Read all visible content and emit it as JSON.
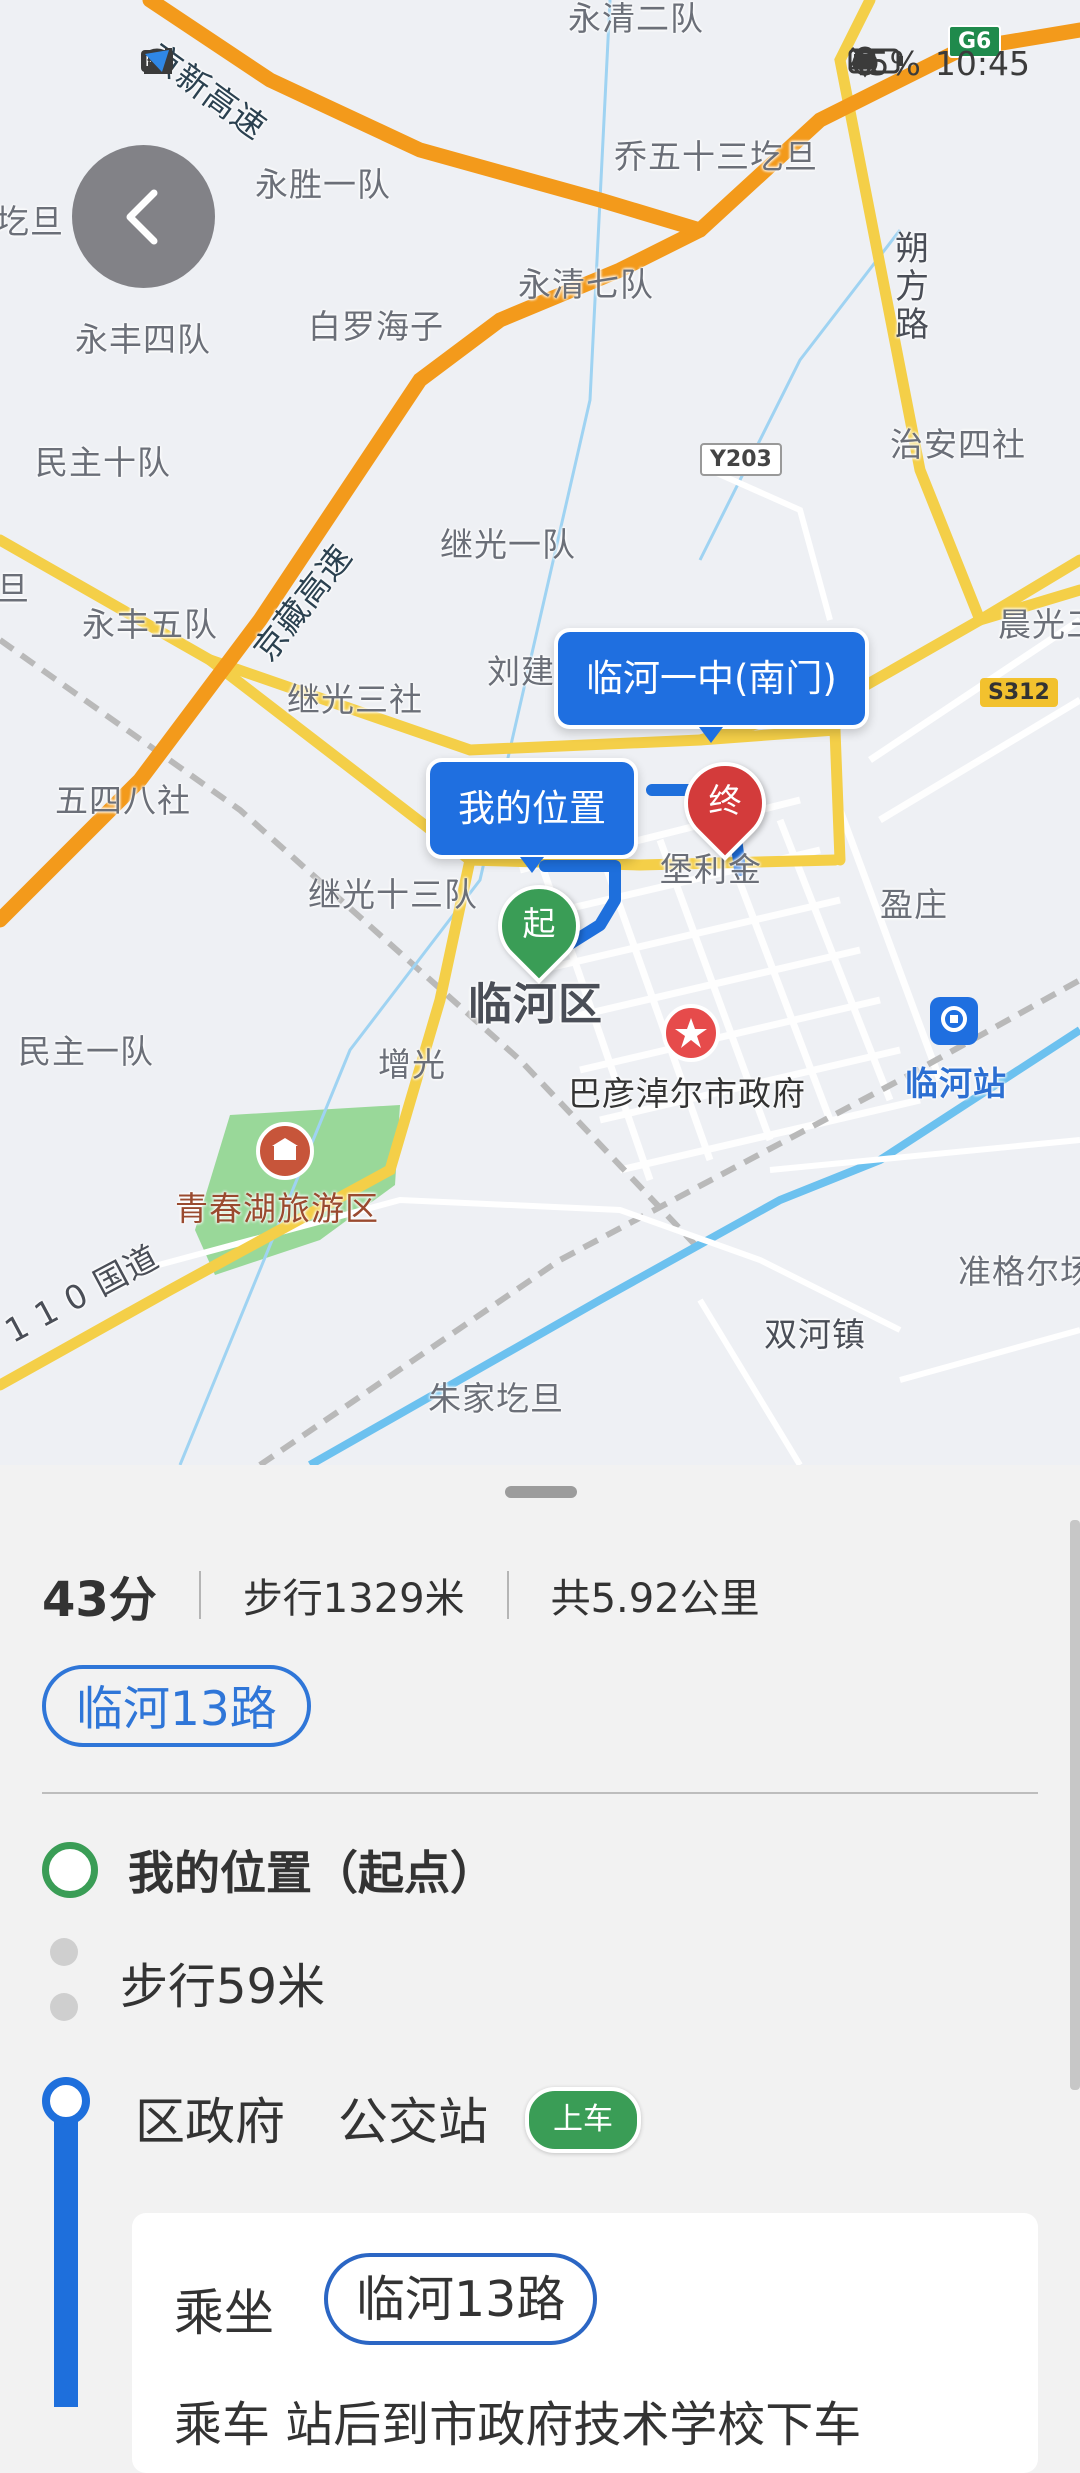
{
  "status_bar": {
    "left_icons": [
      "hd-icon",
      "signal-icon",
      "signal-4g-icon",
      "wifi-icon",
      "app-notification-icon"
    ],
    "battery_percent": "45%",
    "time": "10:45"
  },
  "map": {
    "labels": {
      "yongqing_erdui": "永清二队",
      "qiao_wushisan": "乔五十三圪旦",
      "yongsheng_yidui": "永胜一队",
      "yongqing_qidui": "永清七队",
      "bailuo_haizi": "白罗海子",
      "yongfeng_sidui": "永丰四队",
      "shuofang_lu": "朔方路",
      "zhian_sishe": "治安四社",
      "minzhu_shidui": "民主十队",
      "jiguang_yidui": "继光一队",
      "yongfeng_wudui": "永丰五队",
      "jiguang_sanshe": "继光三社",
      "liujian": "刘建",
      "chenguang": "晨光三",
      "wusi_bashe": "五四八社",
      "baolijin": "堡利金",
      "yingzhuang": "盈庄",
      "jiguang_shisandui": "继光十三队",
      "linhe_qu": "临河区",
      "minzhu_yidui": "民主一队",
      "zengguang": "增光",
      "bayannaoer_gov": "巴彦淖尔市政府",
      "linhe_zhan": "临河站",
      "qingchunhu": "青春湖旅游区",
      "zhungeer": "准格尔场",
      "shuanghe_zhen": "双河镇",
      "zhujia_gedan": "朱家圪旦",
      "dan_left": "圪旦",
      "dan_left2": "旦",
      "guodao_110": "1 1 0 国道",
      "jingxin_gaosu": "京新高速",
      "jingzang_gaosu": "京藏高速"
    },
    "shields": {
      "g6": "G6",
      "y203": "Y203",
      "s312": "S312"
    },
    "callouts": {
      "destination": "临河一中(南门)",
      "origin": "我的位置"
    },
    "pins": {
      "start": "起",
      "end": "终"
    }
  },
  "summary": {
    "duration": "43分",
    "walk_distance": "步行1329米",
    "total_distance": "共5.92公里"
  },
  "route_chip": "临河13路",
  "steps": {
    "start_label": "我的位置（起点）",
    "walk_text": "步行59米",
    "stop_name": "区政府",
    "stop_type": "公交站",
    "board_badge": "上车",
    "ride_label": "乘坐",
    "ride_route": "临河13路",
    "ride_next": "乘车 站后到市政府技术学校下车"
  },
  "colors": {
    "accent_blue": "#1f6fe0",
    "start_green": "#3a9d56",
    "end_red": "#d33b3b",
    "highway_orange": "#f39a1b",
    "road_yellow": "#f4cf48",
    "water_blue": "#6cc1ef",
    "park_green": "#8fd58f"
  }
}
